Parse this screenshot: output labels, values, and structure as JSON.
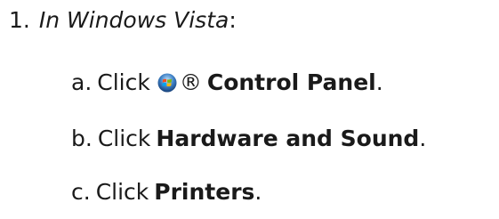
{
  "step1": {
    "marker": "1.",
    "label": "In Windows Vista",
    "colon": ":"
  },
  "step_a": {
    "marker": "a.",
    "prefix": "Click",
    "icon": "windows-start-orb-icon",
    "registered": "®",
    "target": "Control Panel",
    "suffix": "."
  },
  "step_b": {
    "marker": "b.",
    "prefix": "Click",
    "target": "Hardware and Sound",
    "suffix": "."
  },
  "step_c": {
    "marker": "c.",
    "prefix": "Click",
    "target": "Printers",
    "suffix": "."
  }
}
